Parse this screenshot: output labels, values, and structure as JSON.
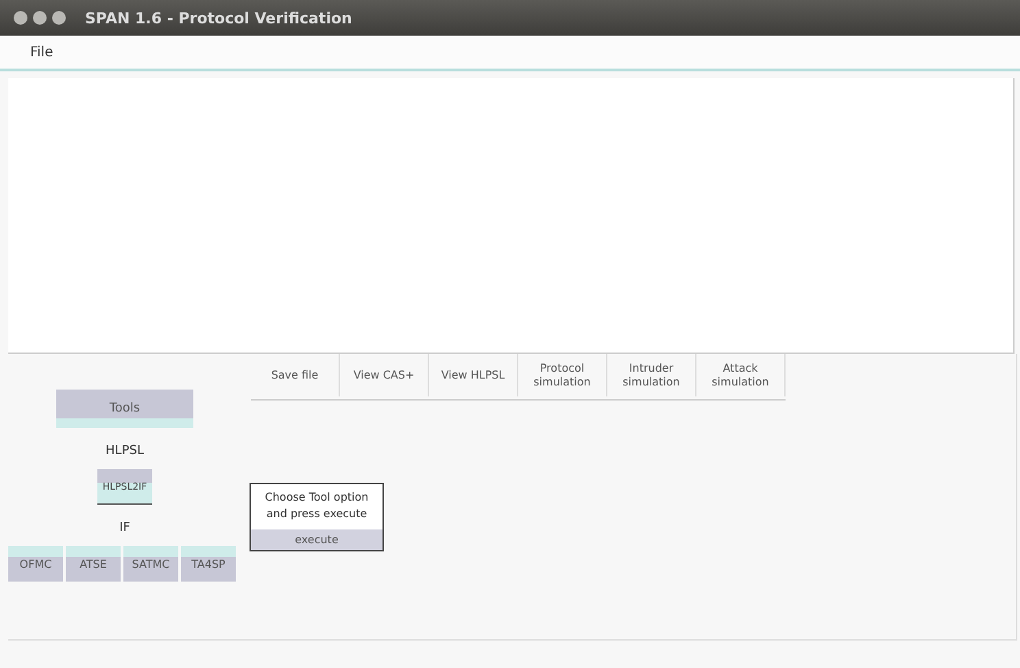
{
  "window": {
    "title": "SPAN 1.6 - Protocol Verification"
  },
  "menu": [
    "File"
  ],
  "actions": [
    "Save file",
    "View CAS+",
    "View HLPSL",
    "Protocol simulation",
    "Intruder simulation",
    "Attack simulation"
  ],
  "tools": {
    "header": "Tools",
    "source": "HLPSL",
    "translator": "HLPSL2IF",
    "target": "IF",
    "backends": [
      "OFMC",
      "ATSE",
      "SATMC",
      "TA4SP"
    ]
  },
  "execute_panel": {
    "message": "Choose Tool option and press execute",
    "button": "execute"
  }
}
